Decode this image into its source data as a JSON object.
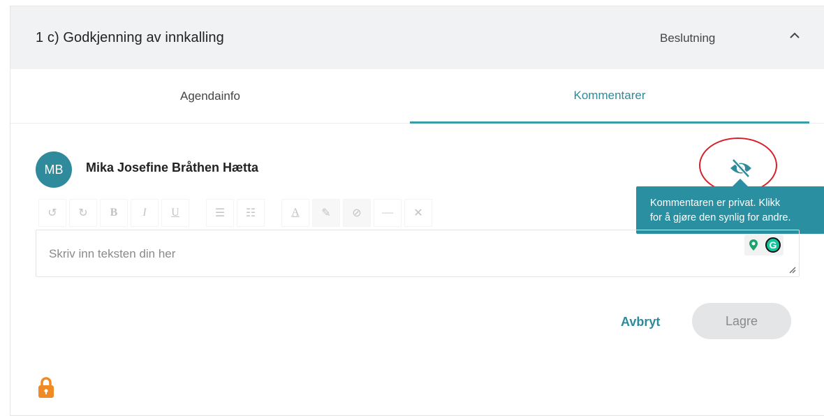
{
  "header": {
    "title": "1 c) Godkjenning av innkalling",
    "tag": "Beslutning"
  },
  "tabs": [
    {
      "label": "Agendainfo"
    },
    {
      "label": "Kommentarer"
    }
  ],
  "comment": {
    "avatar_initials": "MB",
    "author": "Mika Josefine Bråthen Hætta",
    "tooltip_line1": "Kommentaren er privat. Klikk",
    "tooltip_line2": "for å gjøre den synlig for andre.",
    "placeholder": "Skriv inn teksten din her"
  },
  "toolbar": {
    "undo": "↺",
    "redo": "↻",
    "bold": "B",
    "italic": "I",
    "underline": "U",
    "bullet_list": "☰",
    "numbered_list": "☷",
    "text_color": "A",
    "highlight": "✎",
    "clean": "⊘",
    "hr": "—",
    "remove": "✕"
  },
  "grammarly_label": "G",
  "actions": {
    "cancel": "Avbryt",
    "save": "Lagre"
  },
  "colors": {
    "accent": "#2b8b9a",
    "tooltip": "#2a8fa0",
    "highlight_ring": "#d6212a",
    "lock": "#f08a24"
  }
}
